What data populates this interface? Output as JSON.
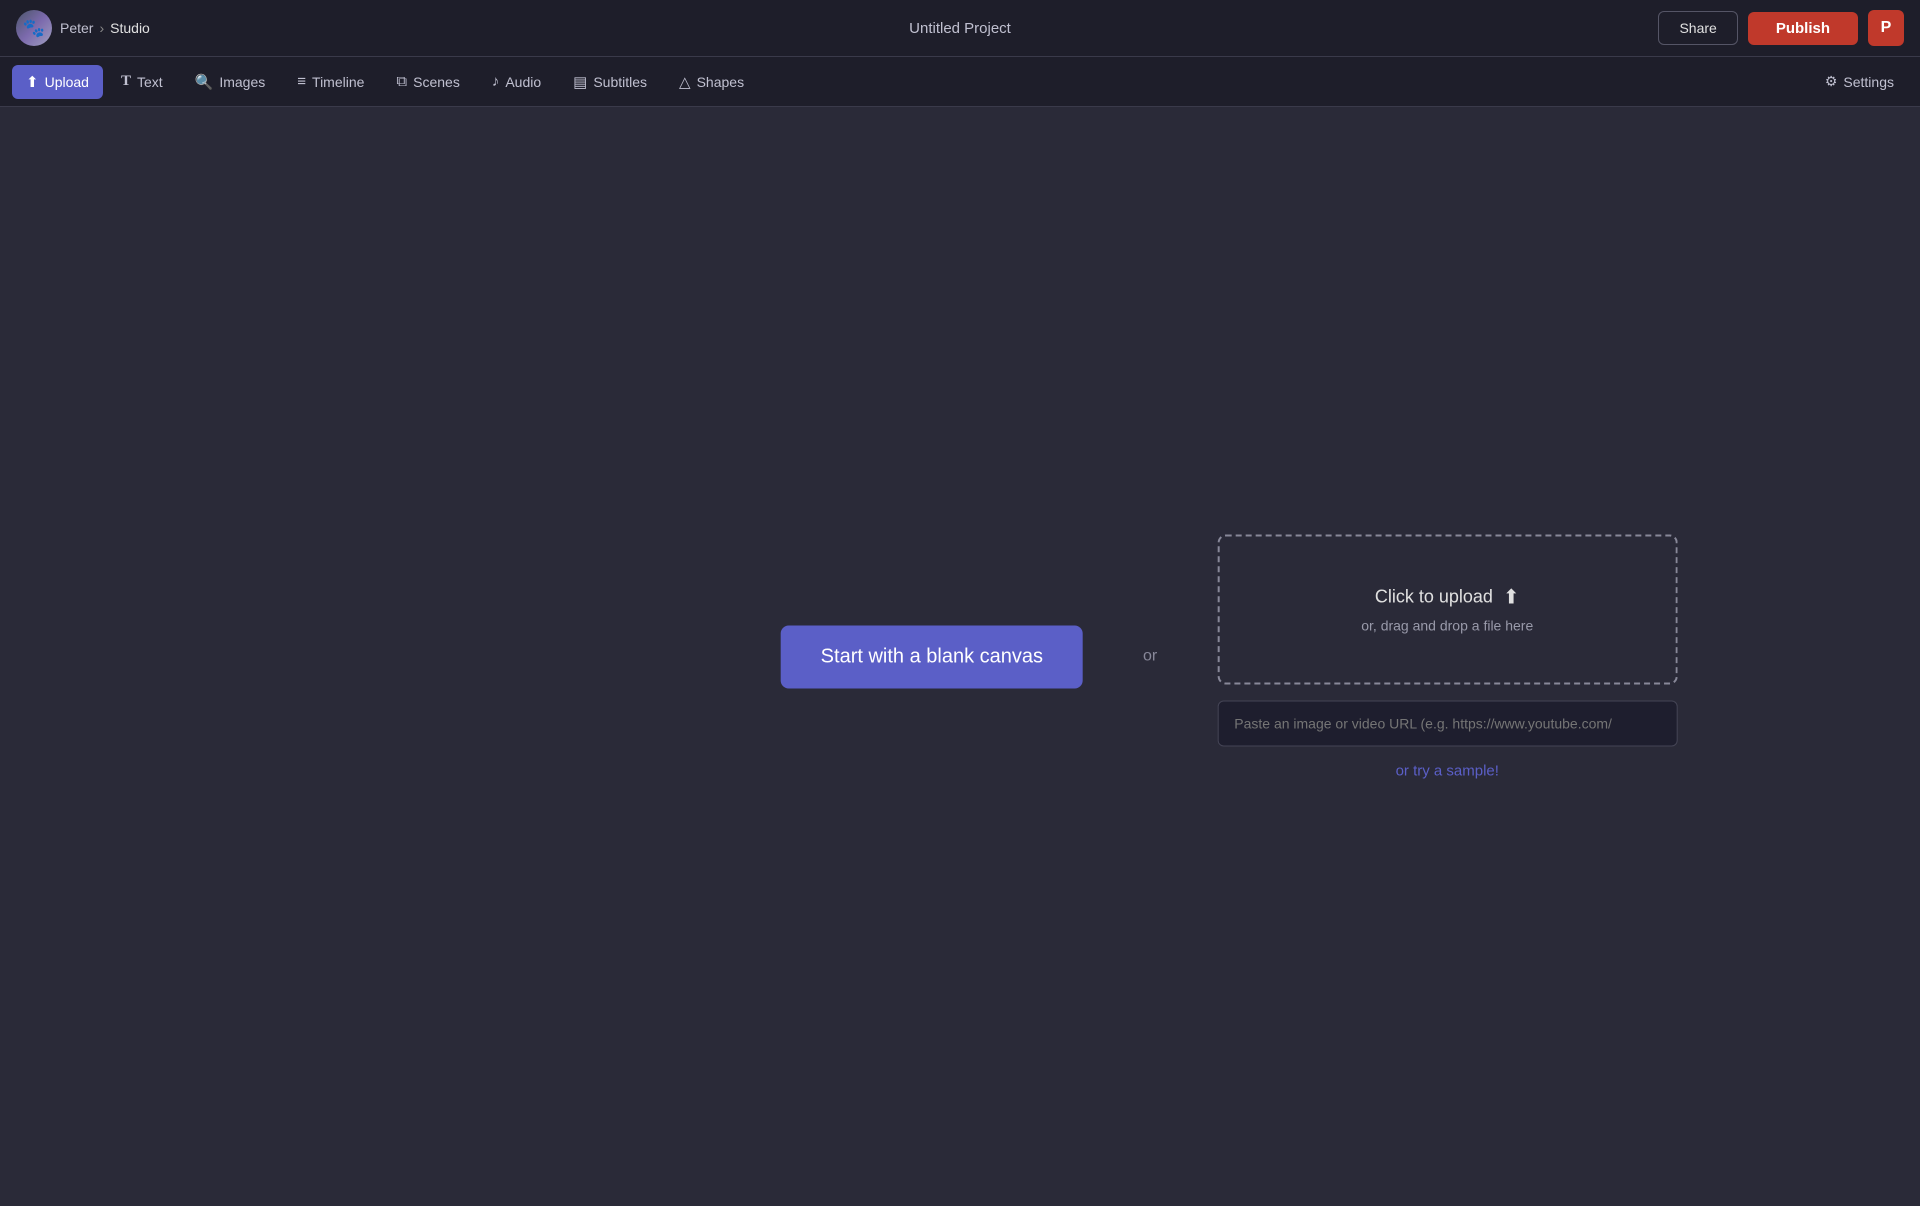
{
  "app": {
    "title": "Untitled Project"
  },
  "topbar": {
    "user_name": "Peter",
    "breadcrumb_separator": "›",
    "breadcrumb_current": "Studio",
    "share_label": "Share",
    "publish_label": "Publish",
    "user_initial": "P"
  },
  "toolbar": {
    "items": [
      {
        "id": "upload",
        "label": "Upload",
        "icon": "⬆"
      },
      {
        "id": "text",
        "label": "Text",
        "icon": "T"
      },
      {
        "id": "images",
        "label": "Images",
        "icon": "🔍"
      },
      {
        "id": "timeline",
        "label": "Timeline",
        "icon": "☰"
      },
      {
        "id": "scenes",
        "label": "Scenes",
        "icon": "⧉"
      },
      {
        "id": "audio",
        "label": "Audio",
        "icon": "♪"
      },
      {
        "id": "subtitles",
        "label": "Subtitles",
        "icon": "▦"
      },
      {
        "id": "shapes",
        "label": "Shapes",
        "icon": "△"
      }
    ],
    "settings_label": "Settings",
    "settings_icon": "⚙"
  },
  "main": {
    "blank_canvas_label": "Start with a blank canvas",
    "or_text": "or",
    "upload_drop_click": "Click to upload",
    "upload_drop_icon": "⬆",
    "upload_drop_drag": "or, drag and drop a file here",
    "url_placeholder": "Paste an image or video URL (e.g. https://www.youtube.com/",
    "try_sample_label": "or try a sample!"
  }
}
